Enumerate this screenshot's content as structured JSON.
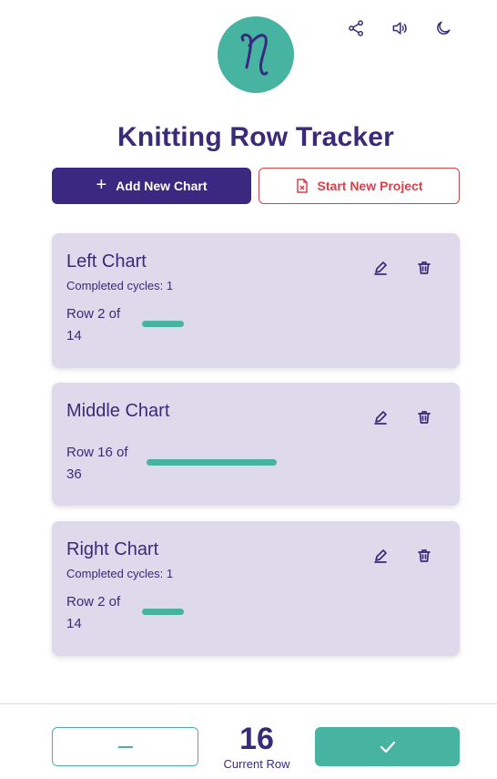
{
  "header": {
    "title": "Knitting Row Tracker",
    "icons": [
      "share-icon",
      "volume-icon",
      "moon-icon"
    ]
  },
  "actions": {
    "add_label": "Add New Chart",
    "new_project_label": "Start New Project"
  },
  "charts": [
    {
      "name": "Left Chart",
      "cycles": "Completed cycles: 1",
      "row_label": "Row 2 of 14",
      "row": 2,
      "total": 14
    },
    {
      "name": "Middle Chart",
      "cycles": "",
      "row_label": "Row 16 of 36",
      "row": 16,
      "total": 36
    },
    {
      "name": "Right Chart",
      "cycles": "Completed cycles: 1",
      "row_label": "Row 2 of 14",
      "row": 2,
      "total": 14
    }
  ],
  "footer": {
    "current_row": "16",
    "current_row_label": "Current Row"
  },
  "colors": {
    "primary": "#3b2880",
    "accent": "#46b4a0",
    "danger": "#d9404a",
    "card_bg": "#dedaec"
  }
}
